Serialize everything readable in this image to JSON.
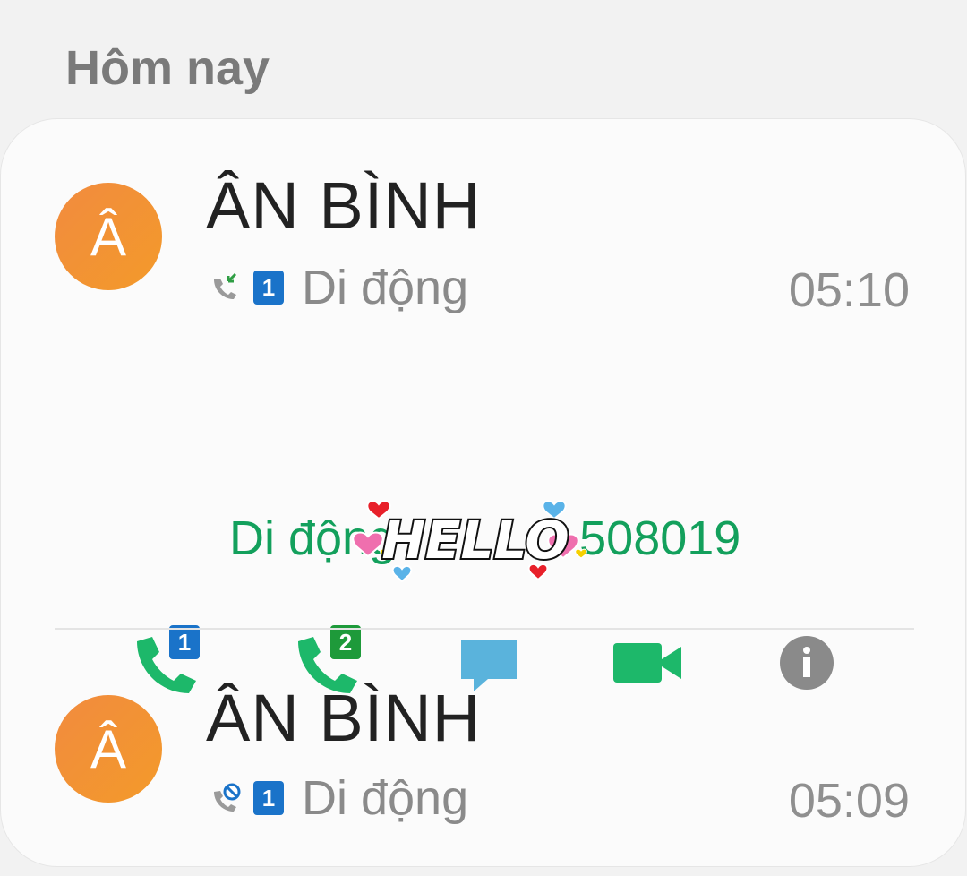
{
  "section": {
    "header": "Hôm nay"
  },
  "calls": [
    {
      "avatar_letter": "Â",
      "name": "ÂN BÌNH",
      "call_type_icon": "incoming-call-icon",
      "sim": "1",
      "type_label": "Di động",
      "time": "05:10"
    },
    {
      "avatar_letter": "Â",
      "name": "ÂN BÌNH",
      "call_type_icon": "rejected-call-icon",
      "sim": "1",
      "type_label": "Di động",
      "time": "05:09"
    }
  ],
  "expanded": {
    "number_label": "Di động",
    "number_visible": "508019"
  },
  "actions": {
    "call_sim1_badge": "1",
    "call_sim2_badge": "2"
  },
  "sticker": {
    "text": "HELLO"
  },
  "colors": {
    "accent_green": "#13a05c",
    "sim1_blue": "#1a73c9",
    "sim2_green": "#1e9a3a",
    "message_blue": "#5ab3dc",
    "video_green": "#1db86a",
    "avatar_orange": "#f28b3f"
  }
}
